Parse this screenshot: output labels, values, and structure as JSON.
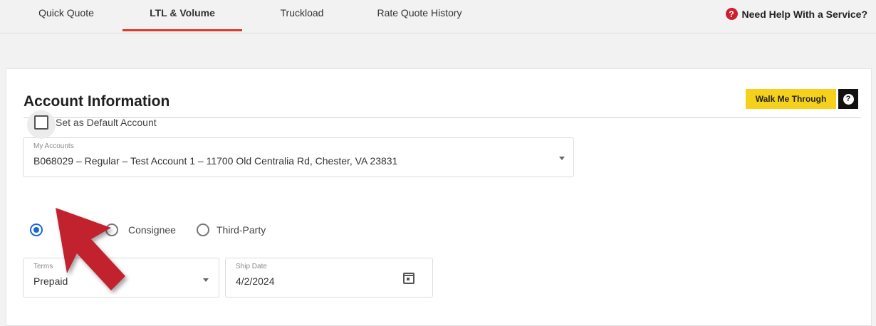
{
  "tabs": [
    {
      "label": "Quick Quote",
      "active": false
    },
    {
      "label": "LTL & Volume",
      "active": true
    },
    {
      "label": "Truckload",
      "active": false
    },
    {
      "label": "Rate Quote History",
      "active": false
    }
  ],
  "help": {
    "label": "Need Help With a Service?",
    "icon": "?"
  },
  "account": {
    "title": "Account Information",
    "walk_label": "Walk Me Through",
    "walk_help_icon": "?",
    "accounts_label": "My Accounts",
    "accounts_value": "B068029 – Regular – Test Account 1 – 11700 Old Centralia Rd, Chester, VA 23831",
    "default_label": "Set as Default Account",
    "default_checked": false,
    "roles": [
      {
        "label": "",
        "checked": true
      },
      {
        "label": "Consignee",
        "checked": false
      },
      {
        "label": "Third-Party",
        "checked": false
      }
    ],
    "terms_label": "Terms",
    "terms_value": "Prepaid",
    "ship_label": "Ship Date",
    "ship_value": "4/2/2024"
  },
  "colors": {
    "accent": "#e03a28",
    "walk": "#f6d11b",
    "radio": "#1a66d6",
    "arrow": "#c1202e"
  }
}
